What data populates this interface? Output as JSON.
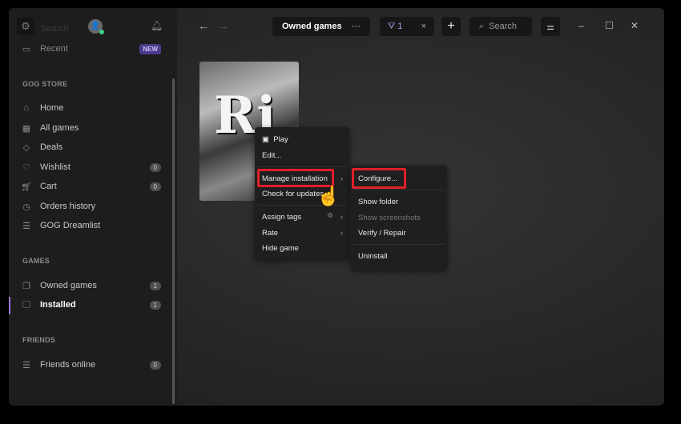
{
  "sidebar": {
    "search_placeholder": "Search",
    "recent": "Recent",
    "new_badge": "NEW",
    "store_title": "GOG STORE",
    "store_items": [
      {
        "label": "Home",
        "icon": "home-icon"
      },
      {
        "label": "All games",
        "icon": "grid-icon"
      },
      {
        "label": "Deals",
        "icon": "tag-icon"
      },
      {
        "label": "Wishlist",
        "icon": "heart-icon",
        "count": "0"
      },
      {
        "label": "Cart",
        "icon": "cart-icon",
        "count": "0"
      },
      {
        "label": "Orders history",
        "icon": "clock-icon"
      },
      {
        "label": "GOG Dreamlist",
        "icon": "list-icon"
      }
    ],
    "games_title": "GAMES",
    "games_items": [
      {
        "label": "Owned games",
        "count": "1"
      },
      {
        "label": "Installed",
        "count": "1"
      }
    ],
    "friends_title": "FRIENDS",
    "friends_items": [
      {
        "label": "Friends online",
        "count": "0"
      }
    ]
  },
  "toolbar": {
    "view": "Owned games",
    "more": "···",
    "filter_count": "1",
    "clear": "×",
    "add": "+",
    "search": "Search"
  },
  "game": {
    "cover_text": "Ri"
  },
  "context_menu": {
    "items": [
      "Play",
      "Edit...",
      "Manage installation",
      "Check for updates",
      "Assign tags",
      "Rate",
      "Hide game"
    ],
    "tag_count": "0"
  },
  "submenu": {
    "items": [
      "Configure...",
      "Show folder",
      "Show screenshots",
      "Verify / Repair",
      "Uninstall"
    ]
  },
  "colors": {
    "highlight": "#e0202a",
    "accent": "#9a7bdc"
  }
}
